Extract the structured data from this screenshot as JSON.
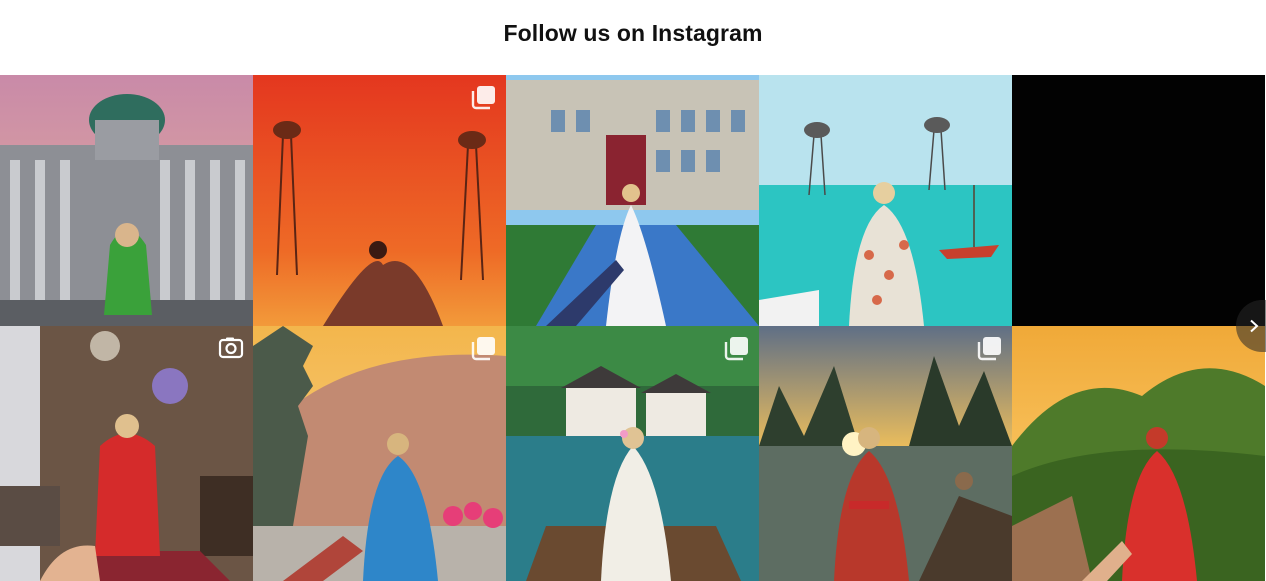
{
  "section": {
    "title": "Follow us on Instagram"
  },
  "posts": [
    {
      "name": "post-cathedral",
      "badge": "none"
    },
    {
      "name": "post-red-desert-elephants",
      "badge": "gallery"
    },
    {
      "name": "post-palace-bride",
      "badge": "none"
    },
    {
      "name": "post-turquoise-sea-elephants",
      "badge": "none"
    },
    {
      "name": "post-dark",
      "badge": "none"
    },
    {
      "name": "post-living-room-jordan",
      "badge": "video"
    },
    {
      "name": "post-pagoda-canyon",
      "badge": "gallery"
    },
    {
      "name": "post-canal-boat",
      "badge": "gallery"
    },
    {
      "name": "post-karst-river",
      "badge": "gallery"
    },
    {
      "name": "post-great-wall",
      "badge": "none"
    }
  ],
  "icons": {
    "gallery": "gallery-icon",
    "video": "camera-icon",
    "next": "chevron-right-icon"
  }
}
